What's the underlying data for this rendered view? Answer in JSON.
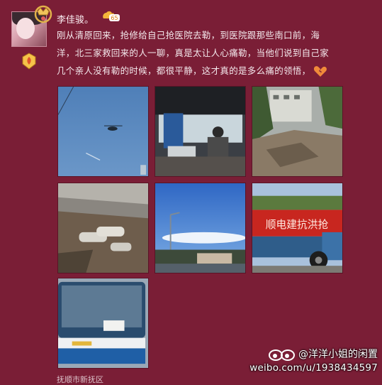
{
  "post": {
    "username": "李佳骏。",
    "vip_level": "65",
    "level_badge_icon": "fire-level-badge-icon",
    "text_lines": [
      "刚从清原回来，抢修给自己抢医院去勒，到医院跟那些南口前，海",
      "洋，北三家救回来的人一聊，真是太让人心痛勒，当他们说到自己家",
      "几个亲人没有勒的时候，都很平静，这才真的是多么痛的领悟，"
    ],
    "location": "抚顺市新抚区"
  },
  "images": [
    {
      "name": "helicopter-photo"
    },
    {
      "name": "bus-interior-photo"
    },
    {
      "name": "collapsed-building-photo"
    },
    {
      "name": "broken-road-pipes-photo"
    },
    {
      "name": "sky-street-photo"
    },
    {
      "name": "truck-banner-photo",
      "banner_text": "顺电建抗洪抢"
    },
    {
      "name": "bus-front-photo"
    }
  ],
  "watermark": {
    "handle": "@洋洋小姐的闲置",
    "url": "weibo.com/u/1938434597"
  },
  "colors": {
    "background": "#7a1e36",
    "text": "#f3e7eb"
  }
}
